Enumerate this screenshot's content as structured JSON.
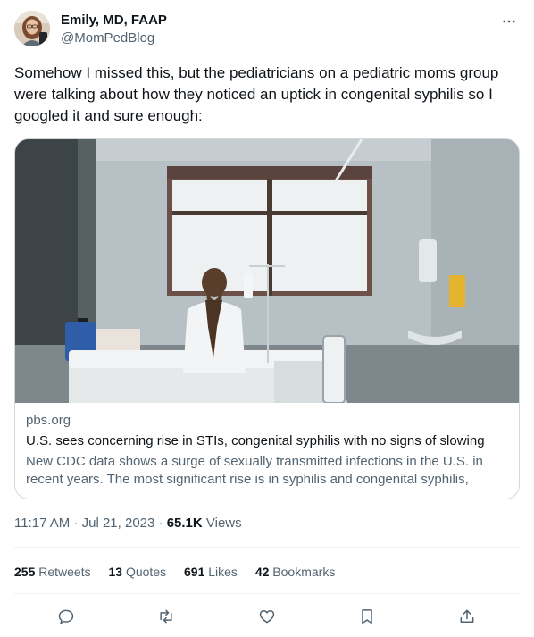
{
  "tweet": {
    "author": {
      "display_name": "Emily, MD, FAAP",
      "handle": "@MomPedBlog",
      "avatar_icon": "avatar"
    },
    "text": "Somehow I missed this, but the pediatricians on a pediatric moms group were talking about how they noticed an uptick in congenital syphilis so I googled it and sure enough:",
    "card": {
      "domain": "pbs.org",
      "title": "U.S. sees concerning rise in STIs, congenital syphilis with no signs of slowing",
      "description": "New CDC data shows a surge of sexually transmitted infections in the U.S. in recent years. The most significant rise is in syphilis and congenital syphilis, which..."
    },
    "meta": {
      "time": "11:17 AM",
      "separator": "·",
      "date": "Jul 21, 2023",
      "views_count": "65.1K",
      "views_label": "Views"
    },
    "stats": {
      "retweets_count": "255",
      "retweets_label": "Retweets",
      "quotes_count": "13",
      "quotes_label": "Quotes",
      "likes_count": "691",
      "likes_label": "Likes",
      "bookmarks_count": "42",
      "bookmarks_label": "Bookmarks"
    },
    "actions": [
      "reply-icon",
      "retweet-icon",
      "like-icon",
      "bookmark-icon",
      "share-icon"
    ]
  },
  "colors": {
    "text_primary": "#0f1419",
    "text_secondary": "#536471",
    "border": "#cfd9de",
    "divider": "#eff3f4"
  }
}
